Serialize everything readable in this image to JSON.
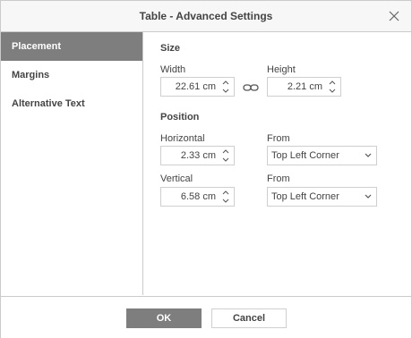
{
  "window": {
    "title": "Table - Advanced Settings",
    "close_icon": "close-icon"
  },
  "sidebar": {
    "items": [
      {
        "label": "Placement",
        "active": true
      },
      {
        "label": "Margins",
        "active": false
      },
      {
        "label": "Alternative Text",
        "active": false
      }
    ]
  },
  "size": {
    "heading": "Size",
    "width_label": "Width",
    "width_value": "22.61 cm",
    "height_label": "Height",
    "height_value": "2.21 cm",
    "link_icon": "link-icon"
  },
  "position": {
    "heading": "Position",
    "horizontal_label": "Horizontal",
    "horizontal_value": "2.33 cm",
    "horizontal_from_label": "From",
    "horizontal_from_value": "Top Left Corner",
    "vertical_label": "Vertical",
    "vertical_value": "6.58 cm",
    "vertical_from_label": "From",
    "vertical_from_value": "Top Left Corner"
  },
  "footer": {
    "ok_label": "OK",
    "cancel_label": "Cancel"
  },
  "colors": {
    "active_sidebar": "#7e7e7e",
    "ok_button": "#7e7e7e",
    "border": "#cbcbcb"
  }
}
